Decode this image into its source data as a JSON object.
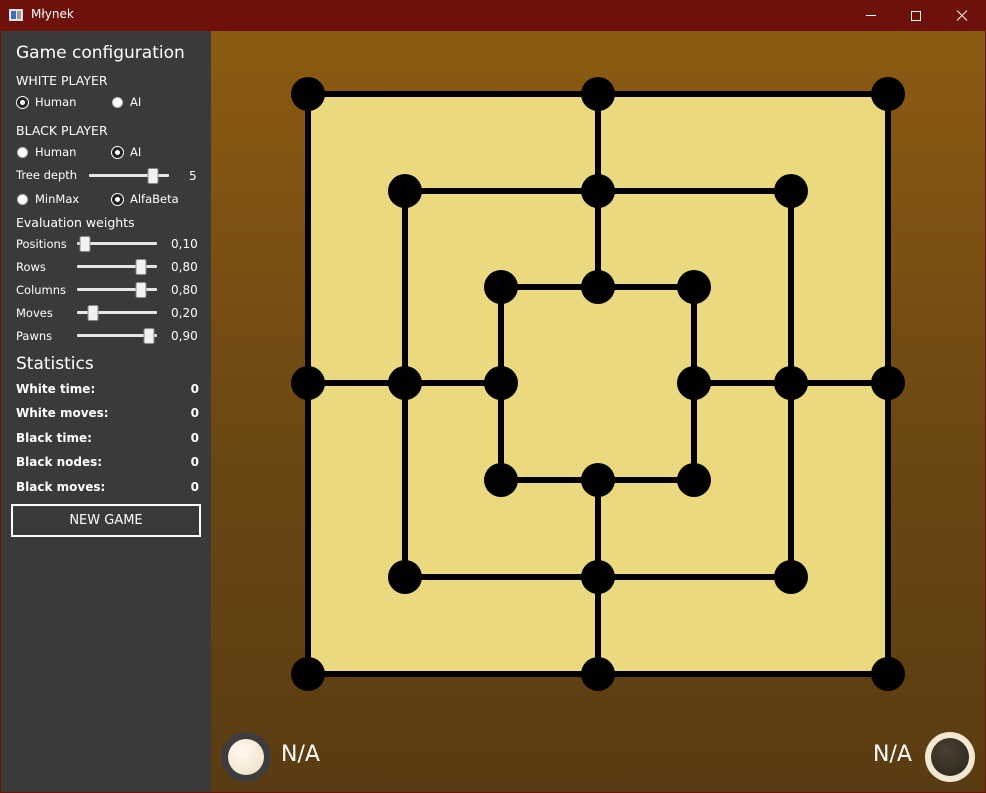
{
  "window": {
    "title": "Młynek"
  },
  "config": {
    "heading": "Game configuration",
    "white_player": {
      "label": "WHITE PLAYER",
      "options": [
        "Human",
        "AI"
      ],
      "selected": "Human"
    },
    "black_player": {
      "label": "BLACK PLAYER",
      "options": [
        "Human",
        "AI"
      ],
      "selected": "AI"
    },
    "tree_depth": {
      "label": "Tree depth",
      "value": "5",
      "level": 0.8
    },
    "algorithm": {
      "options": [
        "MinMax",
        "AlfaBeta"
      ],
      "selected": "AlfaBeta"
    },
    "weights": {
      "heading": "Evaluation weights",
      "items": [
        {
          "label": "Positions",
          "value": "0,10",
          "level": 0.1
        },
        {
          "label": "Rows",
          "value": "0,80",
          "level": 0.8
        },
        {
          "label": "Columns",
          "value": "0,80",
          "level": 0.8
        },
        {
          "label": "Moves",
          "value": "0,20",
          "level": 0.2
        },
        {
          "label": "Pawns",
          "value": "0,90",
          "level": 0.9
        }
      ]
    }
  },
  "statistics": {
    "heading": "Statistics",
    "items": [
      {
        "label": "White time:",
        "value": "0"
      },
      {
        "label": "White moves:",
        "value": "0"
      },
      {
        "label": "Black time:",
        "value": "0"
      },
      {
        "label": "Black nodes:",
        "value": "0"
      },
      {
        "label": "Black moves:",
        "value": "0"
      }
    ]
  },
  "new_game_label": "NEW GAME",
  "players": {
    "white_status": "N/A",
    "black_status": "N/A"
  },
  "colors": {
    "title_bar": "#6f110b",
    "sidebar": "#3a3a3a",
    "board_fill": "#ebd97f",
    "board_lines": "#000000"
  }
}
